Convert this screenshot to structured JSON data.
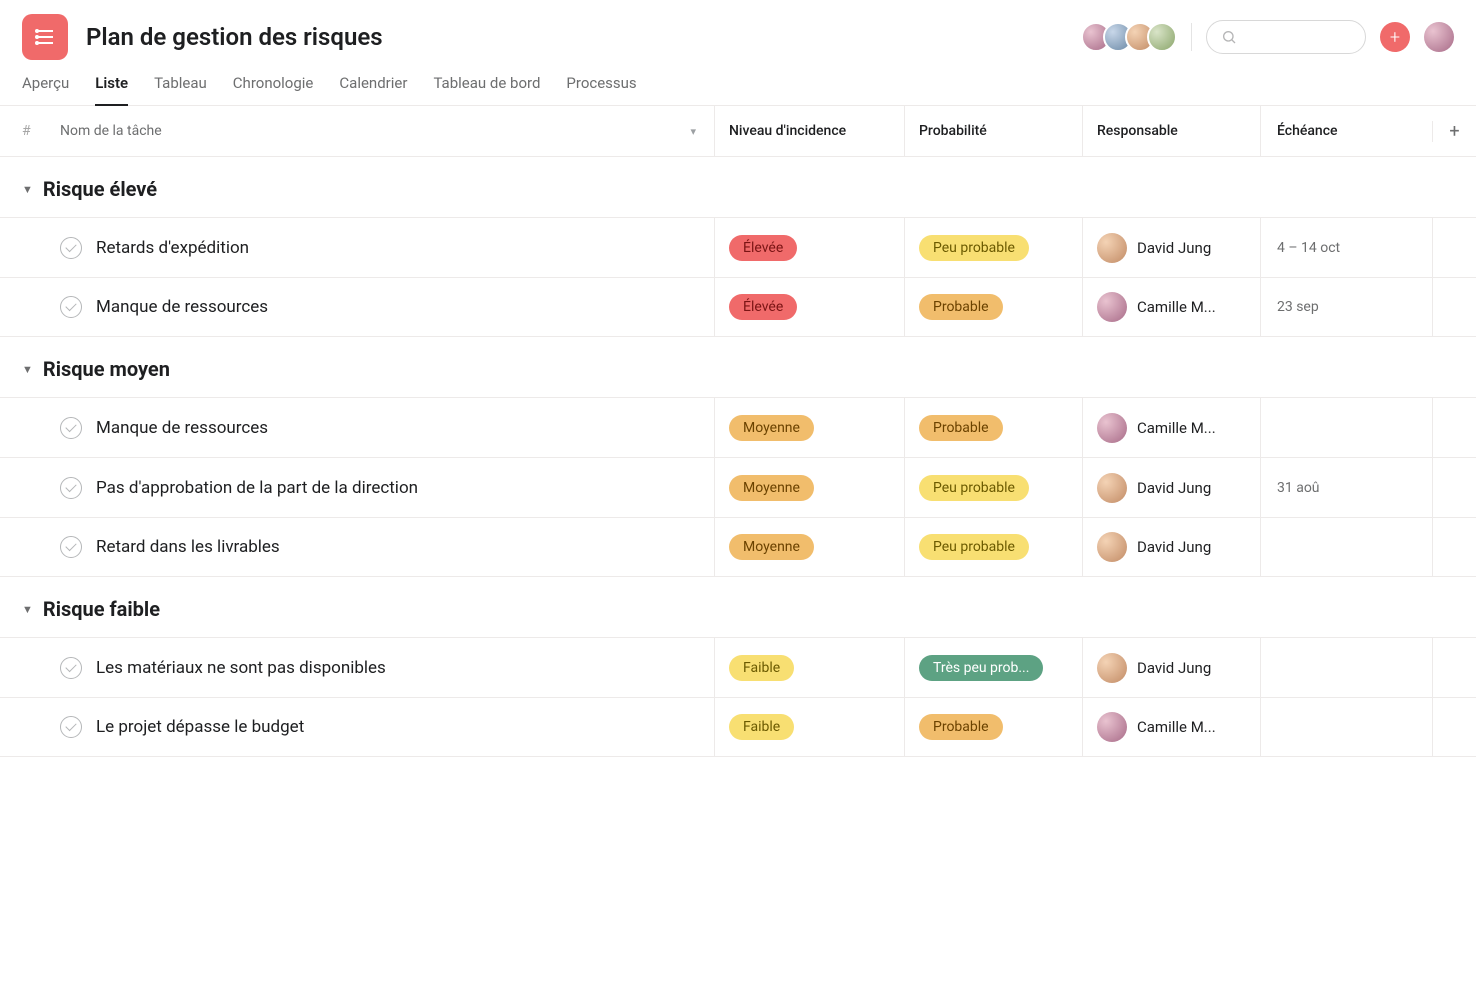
{
  "header": {
    "title": "Plan de gestion des risques"
  },
  "tabs": [
    {
      "id": "apercu",
      "label": "Aperçu",
      "active": false
    },
    {
      "id": "liste",
      "label": "Liste",
      "active": true
    },
    {
      "id": "tableau",
      "label": "Tableau",
      "active": false
    },
    {
      "id": "chronologie",
      "label": "Chronologie",
      "active": false
    },
    {
      "id": "calendrier",
      "label": "Calendrier",
      "active": false
    },
    {
      "id": "tableau-de-bord",
      "label": "Tableau de bord",
      "active": false
    },
    {
      "id": "processus",
      "label": "Processus",
      "active": false
    }
  ],
  "columns": {
    "number": "#",
    "name": "Nom de la tâche",
    "incidence": "Niveau d'incidence",
    "probability": "Probabilité",
    "assignee": "Responsable",
    "due": "Échéance"
  },
  "sections": [
    {
      "title": "Risque élevé",
      "rows": [
        {
          "name": "Retards d'expédition",
          "incidence": {
            "label": "Élevée",
            "color": "red"
          },
          "probability": {
            "label": "Peu probable",
            "color": "yellow"
          },
          "assignee": {
            "name": "David Jung",
            "avatar": "av1"
          },
          "due": "4 – 14 oct"
        },
        {
          "name": "Manque de ressources",
          "incidence": {
            "label": "Élevée",
            "color": "red"
          },
          "probability": {
            "label": "Probable",
            "color": "orange"
          },
          "assignee": {
            "name": "Camille M...",
            "avatar": "av2"
          },
          "due": "23 sep"
        }
      ]
    },
    {
      "title": "Risque moyen",
      "rows": [
        {
          "name": "Manque de ressources",
          "incidence": {
            "label": "Moyenne",
            "color": "orange"
          },
          "probability": {
            "label": "Probable",
            "color": "orange"
          },
          "assignee": {
            "name": "Camille M...",
            "avatar": "av2"
          },
          "due": ""
        },
        {
          "name": "Pas d'approbation de la part de la direction",
          "incidence": {
            "label": "Moyenne",
            "color": "orange"
          },
          "probability": {
            "label": "Peu probable",
            "color": "yellow"
          },
          "assignee": {
            "name": "David Jung",
            "avatar": "av1"
          },
          "due": "31 aoû"
        },
        {
          "name": "Retard dans les livrables",
          "incidence": {
            "label": "Moyenne",
            "color": "orange"
          },
          "probability": {
            "label": "Peu probable",
            "color": "yellow"
          },
          "assignee": {
            "name": "David Jung",
            "avatar": "av1"
          },
          "due": ""
        }
      ]
    },
    {
      "title": "Risque faible",
      "rows": [
        {
          "name": "Les matériaux ne sont pas disponibles",
          "incidence": {
            "label": "Faible",
            "color": "yellow"
          },
          "probability": {
            "label": "Très peu prob...",
            "color": "teal"
          },
          "assignee": {
            "name": "David Jung",
            "avatar": "av1"
          },
          "due": ""
        },
        {
          "name": "Le projet dépasse le budget",
          "incidence": {
            "label": "Faible",
            "color": "yellow"
          },
          "probability": {
            "label": "Probable",
            "color": "orange"
          },
          "assignee": {
            "name": "Camille M...",
            "avatar": "av2"
          },
          "due": ""
        }
      ]
    }
  ]
}
